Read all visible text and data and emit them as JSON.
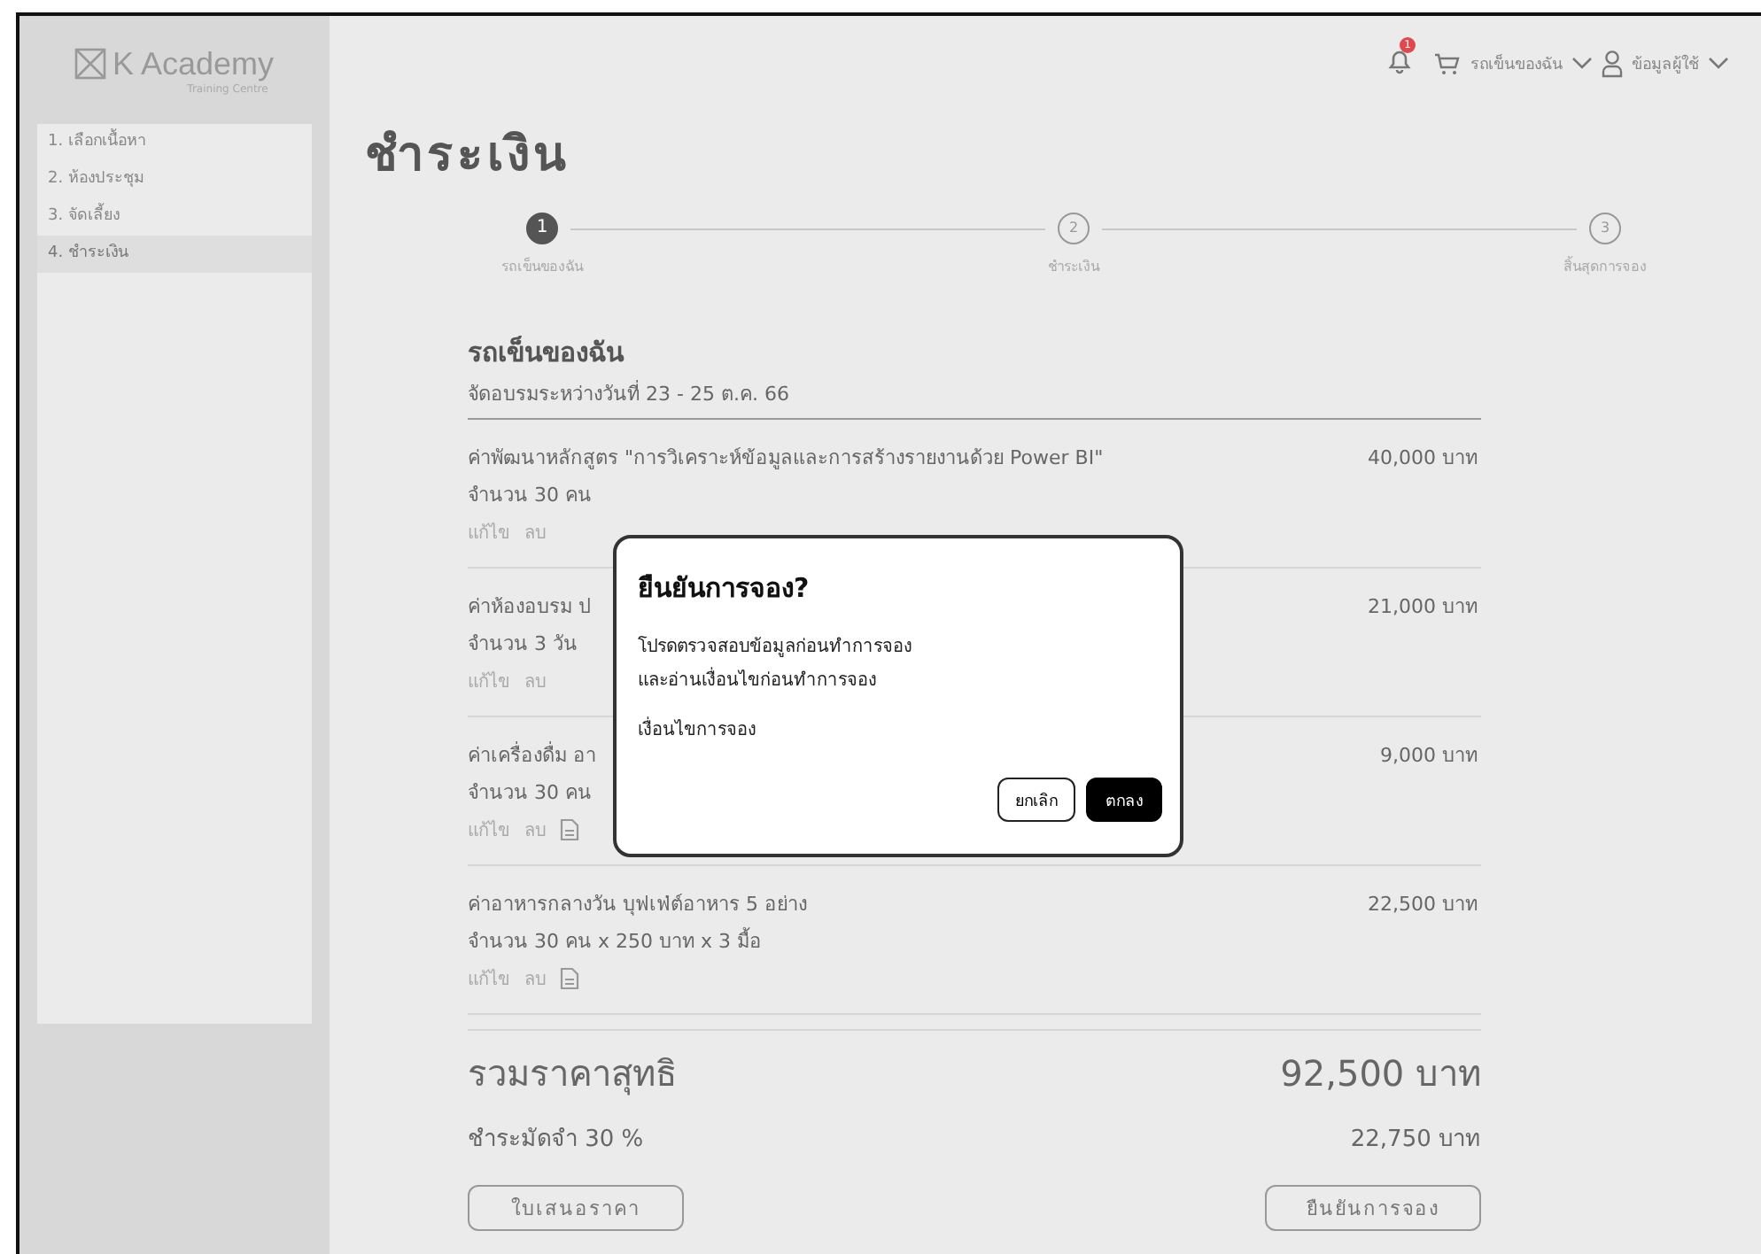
{
  "logo": {
    "name": "K Academy",
    "tagline": "Training Centre"
  },
  "sidebar": {
    "items": [
      {
        "label": "1. เลือกเนื้อหา",
        "selected": false
      },
      {
        "label": "2. ห้องประชุม",
        "selected": false
      },
      {
        "label": "3. จัดเลี้ยง",
        "selected": false
      },
      {
        "label": "4. ชำระเงิน",
        "selected": true
      }
    ]
  },
  "header": {
    "notification_count": "1",
    "cart_label": "รถเข็นของฉัน",
    "user_label": "ข้อมูลผู้ใช้"
  },
  "page_title": "ชำระเงิน",
  "steps": [
    {
      "number": "1",
      "label": "รถเข็นของฉัน",
      "active": true
    },
    {
      "number": "2",
      "label": "ชำระเงิน",
      "active": false
    },
    {
      "number": "3",
      "label": "สิ้นสุดการจอง",
      "active": false
    }
  ],
  "cart": {
    "title": "รถเข็นของฉัน",
    "subtitle": "จัดอบรมระหว่างวันที่ 23 - 25 ต.ค.  66",
    "items": [
      {
        "title": "ค่าพัฒนาหลักสูตร \"การวิเคราะห์ข้อมูลและการสร้างรายงานด้วย Power BI\"",
        "detail": "จำนวน 30 คน",
        "actions": [
          "แก้ไข",
          "ลบ"
        ],
        "has_document": false,
        "price": "40,000 บาท"
      },
      {
        "title": "ค่าห้องอบรม ป",
        "detail": "จำนวน 3 วัน",
        "actions": [
          "แก้ไข",
          "ลบ"
        ],
        "has_document": false,
        "price": "21,000 บาท"
      },
      {
        "title": "ค่าเครื่องดื่ม อา",
        "detail": "จำนวน 30 คน",
        "actions": [
          "แก้ไข",
          "ลบ"
        ],
        "has_document": true,
        "price": "9,000 บาท"
      },
      {
        "title": "ค่าอาหารกลางวัน บุฟเฟ่ต์อาหาร 5 อย่าง",
        "detail": "จำนวน 30 คน x 250 บาท x 3 มื้อ",
        "actions": [
          "แก้ไข",
          "ลบ"
        ],
        "has_document": true,
        "price": "22,500 บาท"
      }
    ],
    "total_label": "รวมราคาสุทธิ",
    "total": "92,500 บาท",
    "deposit_label": "ชำระมัดจำ 30 %",
    "deposit": "22,750 บาท",
    "buttons": [
      "ใบเสนอราคา",
      "ยืนยันการจอง"
    ]
  },
  "dialog": {
    "title": "ยืนยันการจอง?",
    "lines": [
      "โปรดตรวจสอบข้อมูลก่อนทำการจอง",
      "และอ่านเงื่อนไขก่อนทำการจอง"
    ],
    "link": "เงื่อนไขการจอง",
    "cancel": "ยกเลิก",
    "ok": "ตกลง"
  }
}
